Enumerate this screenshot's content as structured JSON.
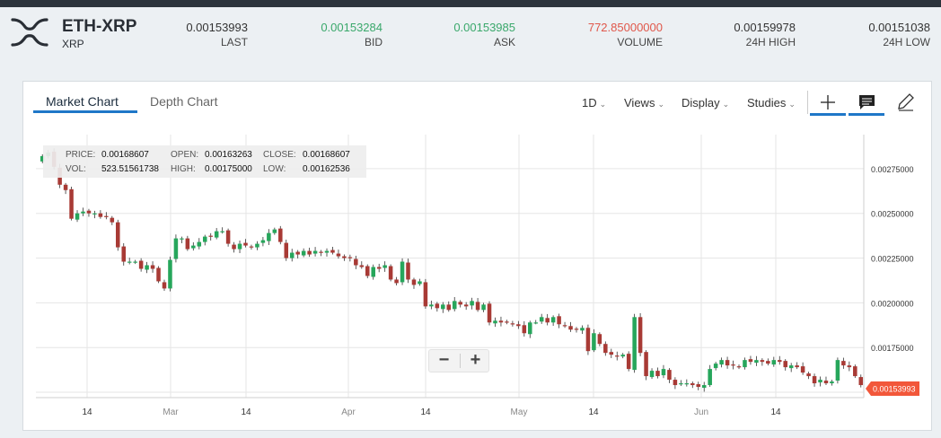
{
  "ticker": {
    "pair": "ETH-XRP",
    "sub": "XRP",
    "stats": [
      {
        "label": "LAST",
        "value": "0.00153993",
        "color": "#333333"
      },
      {
        "label": "BID",
        "value": "0.00153284",
        "color": "#3aa86b"
      },
      {
        "label": "ASK",
        "value": "0.00153985",
        "color": "#3aa86b"
      },
      {
        "label": "VOLUME",
        "value": "772.85000000",
        "color": "#e0574a"
      },
      {
        "label": "24H HIGH",
        "value": "0.00159978",
        "color": "#333333"
      },
      {
        "label": "24H LOW",
        "value": "0.00151038",
        "color": "#333333"
      }
    ]
  },
  "tabs": [
    {
      "label": "Market Chart",
      "active": true
    },
    {
      "label": "Depth Chart",
      "active": false
    }
  ],
  "menus": [
    "1D",
    "Views",
    "Display",
    "Studies"
  ],
  "tools": [
    {
      "icon": "crosshair-icon",
      "active": true
    },
    {
      "icon": "comment-icon",
      "active": true
    },
    {
      "icon": "pencil-icon",
      "active": false
    }
  ],
  "info": {
    "price_label": "PRICE:",
    "price": "0.00168607",
    "open_label": "OPEN:",
    "open": "0.00163263",
    "close_label": "CLOSE:",
    "close": "0.00168607",
    "vol_label": "VOL:",
    "vol": "523.51561738",
    "high_label": "HIGH:",
    "high": "0.00175000",
    "low_label": "LOW:",
    "low": "0.00162536"
  },
  "zoom": {
    "minus": "−",
    "plus": "+"
  },
  "chart_data": {
    "type": "candlestick",
    "interval": "1D",
    "x_ticks": [
      "14",
      "Mar",
      "14",
      "Apr",
      "14",
      "May",
      "14",
      "Jun",
      "14"
    ],
    "y_ticks": [
      "0.00275000",
      "0.00250000",
      "0.00225000",
      "0.00200000",
      "0.00175000",
      "0.00150000"
    ],
    "y_tick_values": [
      0.00275,
      0.0025,
      0.00225,
      0.002,
      0.00175,
      0.0015
    ],
    "ylim": [
      0.00147,
      0.00294
    ],
    "current_price_label": "0.00153993",
    "up_color": "#26a65b",
    "down_color": "#a83a35",
    "grid": true,
    "closes": [
      0.00282,
      0.00284,
      0.00276,
      0.00266,
      0.00263,
      0.00247,
      0.0025,
      0.00251,
      0.0025,
      0.0025,
      0.00248,
      0.00248,
      0.00245,
      0.00231,
      0.00223,
      0.00223,
      0.00223,
      0.00219,
      0.00221,
      0.00219,
      0.00212,
      0.00208,
      0.00224,
      0.00236,
      0.00236,
      0.0023,
      0.00232,
      0.00234,
      0.00237,
      0.00237,
      0.0024,
      0.0024,
      0.00233,
      0.0023,
      0.00233,
      0.00232,
      0.00231,
      0.00233,
      0.00235,
      0.00239,
      0.00241,
      0.00234,
      0.00225,
      0.00228,
      0.00227,
      0.00229,
      0.00227,
      0.00229,
      0.00228,
      0.00229,
      0.00228,
      0.00226,
      0.00225,
      0.00225,
      0.00221,
      0.0022,
      0.00215,
      0.0022,
      0.00219,
      0.00221,
      0.00213,
      0.00211,
      0.00223,
      0.00213,
      0.0021,
      0.00212,
      0.00198,
      0.00199,
      0.00197,
      0.00199,
      0.00196,
      0.00201,
      0.00199,
      0.00198,
      0.00201,
      0.00196,
      0.00199,
      0.00189,
      0.0019,
      0.00189,
      0.00189,
      0.00188,
      0.00187,
      0.00183,
      0.00189,
      0.00189,
      0.00192,
      0.00189,
      0.00192,
      0.00188,
      0.00187,
      0.00185,
      0.00185,
      0.00186,
      0.00173,
      0.00183,
      0.00177,
      0.00172,
      0.00171,
      0.0017,
      0.00171,
      0.00163,
      0.00192,
      0.00172,
      0.00159,
      0.00162,
      0.00159,
      0.00163,
      0.00157,
      0.00154,
      0.00155,
      0.00155,
      0.00154,
      0.00153,
      0.00154,
      0.00163,
      0.00166,
      0.00168,
      0.00165,
      0.00165,
      0.00164,
      0.00168,
      0.00167,
      0.00168,
      0.00167,
      0.00166,
      0.00168,
      0.00167,
      0.00164,
      0.00165,
      0.00164,
      0.00161,
      0.00159,
      0.00155,
      0.00157,
      0.00155,
      0.00156,
      0.00168,
      0.00165,
      0.00164,
      0.00159,
      0.00154
    ],
    "ohlc_sample_last_shown": {
      "open": 0.00163263,
      "high": 0.00175,
      "low": 0.00162536,
      "close": 0.00168607,
      "volume": 523.51561738
    }
  }
}
